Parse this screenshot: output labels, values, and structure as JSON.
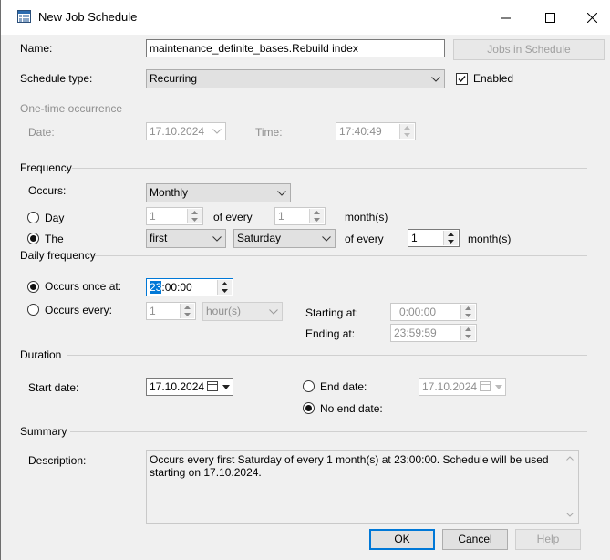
{
  "window": {
    "title": "New Job Schedule"
  },
  "titlebar_icons": [
    "calendar-grid-icon",
    "minimize-icon",
    "maximize-icon",
    "close-icon"
  ],
  "general": {
    "name_label": "Name:",
    "name_value": "maintenance_definite_bases.Rebuild index",
    "jobs_in_schedule_button": "Jobs in Schedule",
    "schedule_type_label": "Schedule type:",
    "schedule_type_value": "Recurring",
    "enabled_label": "Enabled",
    "enabled_checked": true
  },
  "one_time": {
    "section_label": "One-time occurrence",
    "date_label": "Date:",
    "date_value": "17.10.2024",
    "time_label": "Time:",
    "time_value": "17:40:49"
  },
  "frequency": {
    "section_label": "Frequency",
    "occurs_label": "Occurs:",
    "occurs_value": "Monthly",
    "day_option_label": "Day",
    "day_value": "1",
    "of_every_label": "of every",
    "day_months_value": "1",
    "months_label": "month(s)",
    "the_option_label": "The",
    "ordinal_value": "first",
    "weekday_value": "Saturday",
    "the_of_every_label": "of every",
    "the_months_value": "1",
    "the_months_label": "month(s)",
    "selected": "The"
  },
  "daily": {
    "section_label": "Daily frequency",
    "once_label": "Occurs once at:",
    "once_value_selected": "23",
    "once_value_rest": ":00:00",
    "every_label": "Occurs every:",
    "every_value": "1",
    "every_unit": "hour(s)",
    "starting_label": "Starting at:",
    "starting_value": "0:00:00",
    "ending_label": "Ending at:",
    "ending_value": "23:59:59",
    "selected": "Occurs once at"
  },
  "duration": {
    "section_label": "Duration",
    "start_label": "Start date:",
    "start_value": "17.10.2024",
    "end_date_label": "End date:",
    "end_date_value": "17.10.2024",
    "no_end_label": "No end date:",
    "selected": "No end date"
  },
  "summary": {
    "section_label": "Summary",
    "description_label": "Description:",
    "description_text": "Occurs every first Saturday of every 1 month(s) at 23:00:00. Schedule will be used starting on 17.10.2024."
  },
  "buttons": {
    "ok": "OK",
    "cancel": "Cancel",
    "help": "Help"
  }
}
